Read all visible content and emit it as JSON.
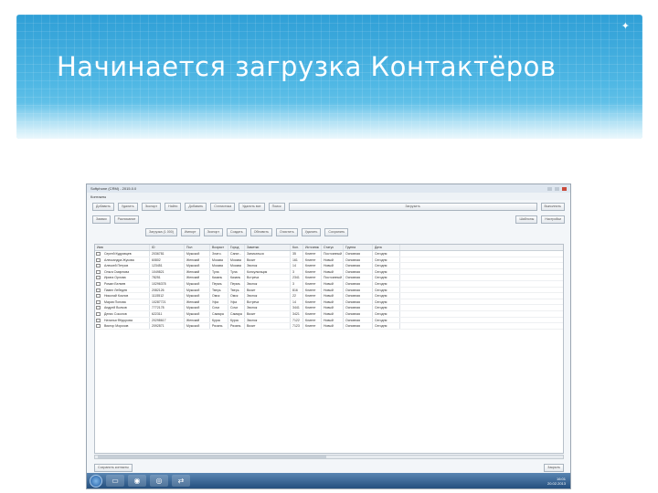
{
  "slide": {
    "title": "Начинается загрузка Контактёров"
  },
  "window": {
    "title": "Softphone (CRM) - 2015.0.0",
    "menu": "Контакты",
    "toolbar": [
      "Добавить",
      "Удалить",
      "Экспорт",
      "Найти",
      "Добавить",
      "Статистика",
      "Удалить все",
      "Поиск",
      "Загрузить",
      "Выполнить"
    ],
    "toolbar2": [
      "Заявки",
      "Расписание",
      "Шаблоны",
      "Настройки"
    ],
    "center_buttons": [
      "Загрузка (1 000)",
      "Импорт",
      "Экспорт",
      "Создать",
      "Обновить",
      "Очистить",
      "Удалить",
      "Сохранить"
    ],
    "columns": [
      "Имя",
      "ID",
      "Пол",
      "Возраст",
      "Город",
      "Заметки",
      "Кол.",
      "Источник",
      "Статус",
      "Группа",
      "Дата"
    ],
    "rows": [
      [
        "Сергей Кудрявцев",
        "2036781",
        "Мужской",
        "Злато.",
        "Санкт...",
        "Записаться",
        "35",
        "Клиент",
        "Постоянный",
        "Основная",
        "Сегодня"
      ],
      [
        "Александра Жукова",
        "60802",
        "Женский",
        "Москва",
        "Москва",
        "Визит",
        "161",
        "Клиент",
        "Новый",
        "Основная",
        "Сегодня"
      ],
      [
        "Алексей Петров",
        "123451",
        "Мужской",
        "Москва",
        "Москва",
        "Звонок",
        "14",
        "Клиент",
        "Новый",
        "Основная",
        "Сегодня"
      ],
      [
        "Ольга Смирнова",
        "1049821",
        "Женский",
        "Тула",
        "Тула",
        "Консультация",
        "3",
        "Клиент",
        "Новый",
        "Основная",
        "Сегодня"
      ],
      [
        "Ирина Орлова",
        "78251",
        "Женский",
        "Казань",
        "Казань",
        "Встреча",
        "2341",
        "Клиент",
        "Постоянный",
        "Основная",
        "Сегодня"
      ],
      [
        "Роман Беляев",
        "10296378",
        "Мужской",
        "Пермь",
        "Пермь",
        "Звонок",
        "3",
        "Клиент",
        "Новый",
        "Основная",
        "Сегодня"
      ],
      [
        "Павел Лебедев",
        "2082126",
        "Мужской",
        "Тверь",
        "Тверь",
        "Визит",
        "816",
        "Клиент",
        "Новый",
        "Основная",
        "Сегодня"
      ],
      [
        "Николай Козлов",
        "1115512",
        "Мужской",
        "Омск",
        "Омск",
        "Звонок",
        "22",
        "Клиент",
        "Новый",
        "Основная",
        "Сегодня"
      ],
      [
        "Мария Попова",
        "10287721",
        "Женский",
        "Уфа",
        "Уфа",
        "Встреча",
        "14",
        "Клиент",
        "Новый",
        "Основная",
        "Сегодня"
      ],
      [
        "Андрей Волков",
        "7772178",
        "Мужской",
        "Сочи",
        "Сочи",
        "Звонок",
        "3441",
        "Клиент",
        "Новый",
        "Основная",
        "Сегодня"
      ],
      [
        "Денис Соколов",
        "622311",
        "Мужской",
        "Самара",
        "Самара",
        "Визит",
        "3421",
        "Клиент",
        "Новый",
        "Основная",
        "Сегодня"
      ],
      [
        "Наталья Фёдорова",
        "20298617",
        "Женский",
        "Курск",
        "Курск",
        "Звонок",
        "7122",
        "Клиент",
        "Новый",
        "Основная",
        "Сегодня"
      ],
      [
        "Виктор Морозов",
        "2092871",
        "Мужской",
        "Рязань",
        "Рязань",
        "Визит",
        "7123",
        "Клиент",
        "Новый",
        "Основная",
        "Сегодня"
      ]
    ],
    "bottom_left": "Сохранить контакты",
    "bottom_right": "Закрыть",
    "tray_time": "16:01",
    "tray_date": "20.02.2013"
  }
}
